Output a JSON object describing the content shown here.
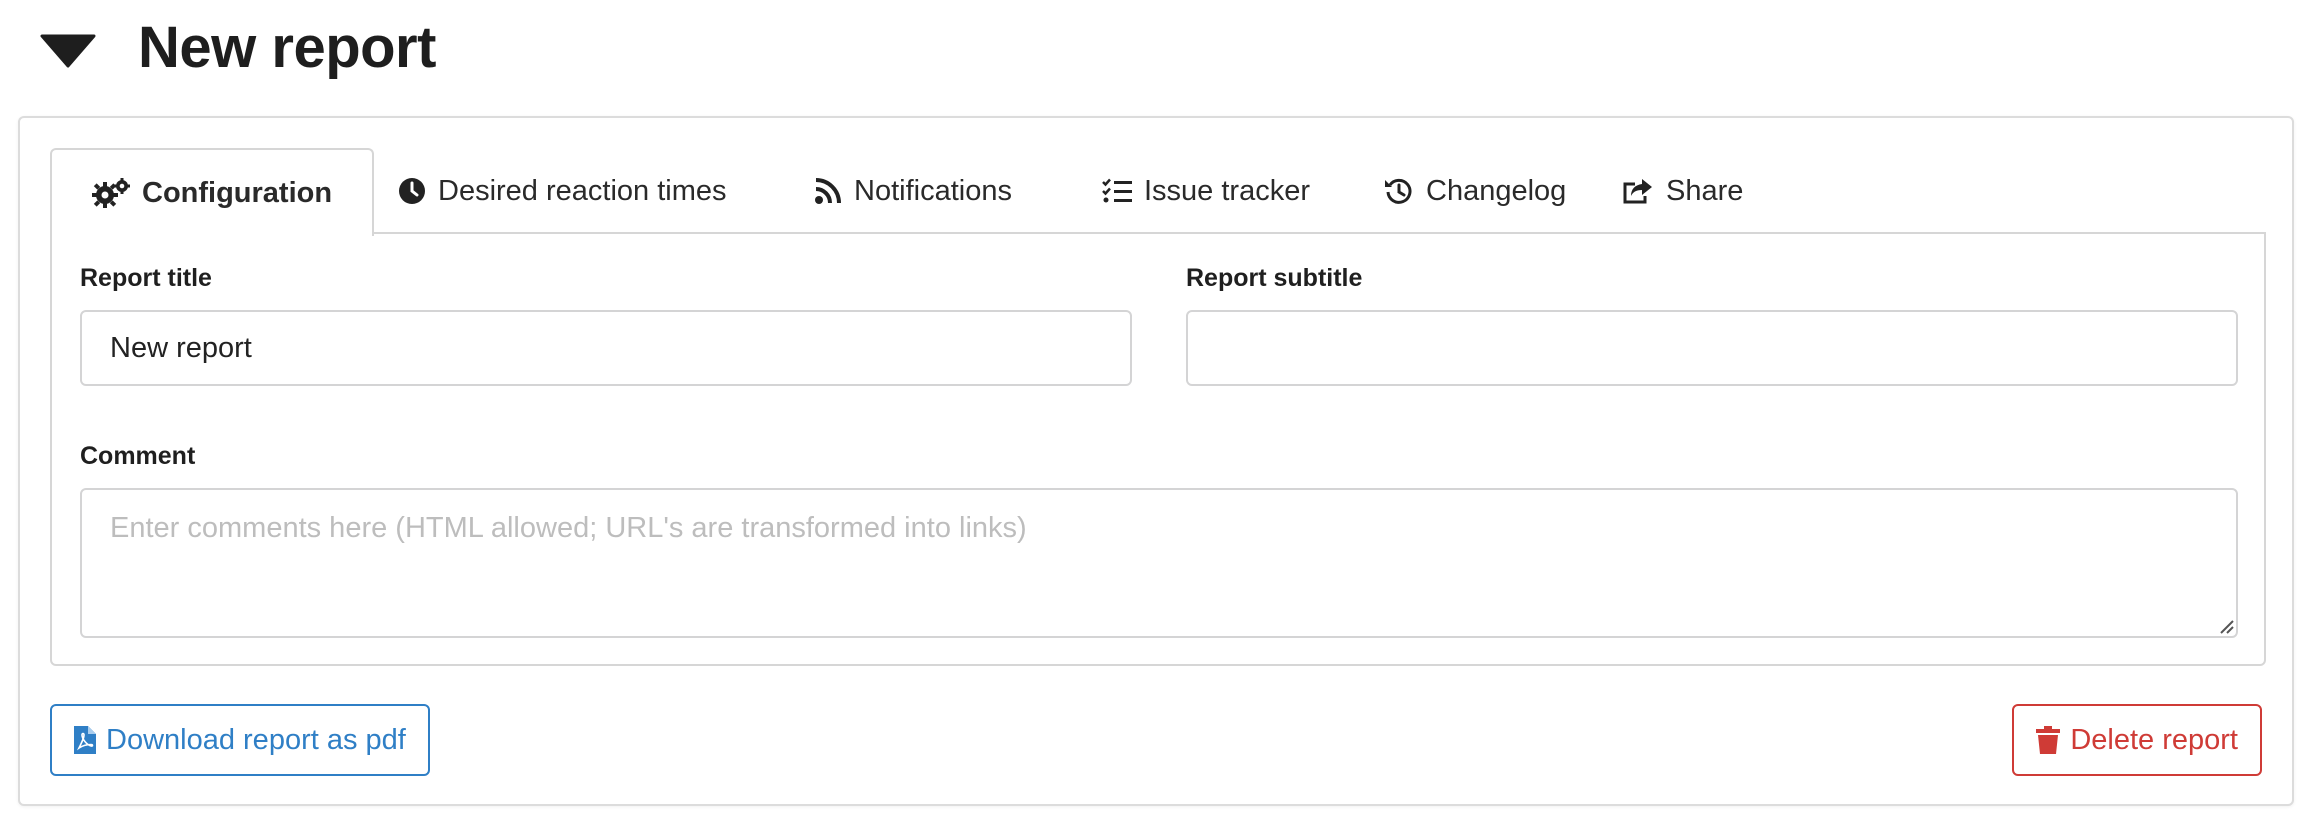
{
  "header": {
    "title": "New report",
    "toggle_icon": "caret-down-icon"
  },
  "tabs": [
    {
      "label": "Configuration",
      "icon": "gears-icon",
      "active": true
    },
    {
      "label": "Desired reaction times",
      "icon": "clock-icon",
      "active": false
    },
    {
      "label": "Notifications",
      "icon": "rss-icon",
      "active": false
    },
    {
      "label": "Issue tracker",
      "icon": "tasks-list-icon",
      "active": false
    },
    {
      "label": "Changelog",
      "icon": "history-icon",
      "active": false
    },
    {
      "label": "Share",
      "icon": "share-icon",
      "active": false
    }
  ],
  "form": {
    "title_label": "Report title",
    "title_value": "New report",
    "subtitle_label": "Report subtitle",
    "subtitle_value": "",
    "comment_label": "Comment",
    "comment_placeholder": "Enter comments here (HTML allowed; URL's are transformed into links)"
  },
  "actions": {
    "download_label": "Download report as pdf",
    "download_icon": "file-pdf-icon",
    "delete_label": "Delete report",
    "delete_icon": "trash-icon"
  },
  "colors": {
    "primary_blue": "#2f7fc6",
    "danger_red": "#cf3b36",
    "border_gray": "#d4d4d5",
    "text_dark": "#222222"
  }
}
